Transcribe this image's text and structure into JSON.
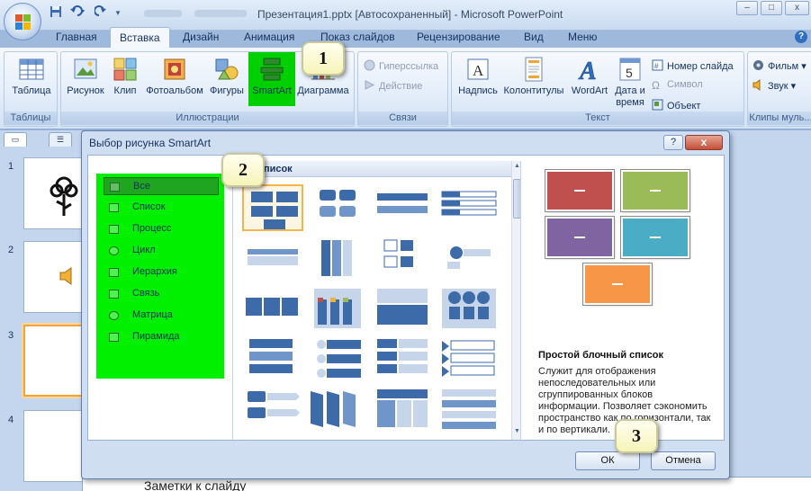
{
  "window": {
    "title": "Презентация1.pptx [Автосохраненный] - Microsoft PowerPoint",
    "minimize": "–",
    "maximize": "□",
    "close": "x"
  },
  "tabs": [
    "Главная",
    "Вставка",
    "Дизайн",
    "Анимация",
    "Показ слайдов",
    "Рецензирование",
    "Вид",
    "Меню"
  ],
  "ribbon": {
    "tables": {
      "table": "Таблица",
      "group": "Таблицы"
    },
    "illustrations": {
      "picture": "Рисунок",
      "clip": "Клип",
      "album": "Фотоальбом",
      "shapes": "Фигуры",
      "smartart": "SmartArt",
      "chart": "Диаграмма",
      "group": "Иллюстрации"
    },
    "links": {
      "hyperlink": "Гиперссылка",
      "action": "Действие",
      "group": "Связи"
    },
    "text": {
      "textbox": "Надпись",
      "header_footer": "Колонтитулы",
      "wordart": "WordArt",
      "datetime_1": "Дата и",
      "datetime_2": "время",
      "slide_number": "Номер слайда",
      "symbol": "Символ",
      "object": "Объект",
      "group": "Текст"
    },
    "media": {
      "movie": "Фильм",
      "sound": "Звук",
      "group": "Клипы муль..."
    }
  },
  "slides": {
    "numbers": [
      "1",
      "2",
      "3",
      "4"
    ]
  },
  "notes": {
    "placeholder": "Заметки к слайду"
  },
  "dialog": {
    "title": "Выбор рисунка SmartArt",
    "help": "?",
    "close": "x",
    "categories": [
      "Все",
      "Список",
      "Процесс",
      "Цикл",
      "Иерархия",
      "Связь",
      "Матрица",
      "Пирамида"
    ],
    "selected_category": "Все",
    "list_header": "Список",
    "preview": {
      "title": "Простой блочный список",
      "description": "Служит для отображения непоследовательных или сгруппированных блоков информации. Позволяет сэкономить пространство как по горизонтали, так и по вертикали.",
      "colors": [
        "#c0504d",
        "#9bbb59",
        "#8064a2",
        "#4bacc6",
        "#f79646"
      ]
    },
    "ok": "ОК",
    "cancel": "Отмена"
  },
  "callouts": [
    "1",
    "2",
    "3"
  ],
  "colors": {
    "highlight": "#00f000",
    "accent": "#4f81bd"
  }
}
